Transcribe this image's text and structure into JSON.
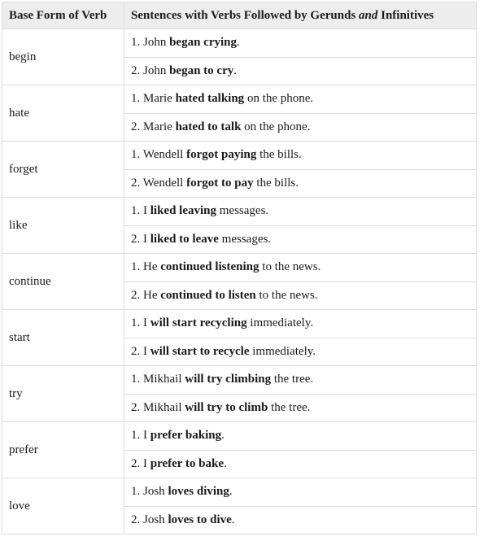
{
  "table": {
    "headers": {
      "verb": "Base Form of Verb",
      "sentences_pre": "Sentences with Verbs Followed by Gerunds ",
      "sentences_italic": "and",
      "sentences_post": " Infinitives"
    },
    "rows": [
      {
        "verb": "begin",
        "sentences": [
          {
            "num": "1.",
            "pre": "John ",
            "bold": "began crying",
            "post": "."
          },
          {
            "num": "2.",
            "pre": "John ",
            "bold": "began to cry",
            "post": "."
          }
        ]
      },
      {
        "verb": "hate",
        "sentences": [
          {
            "num": "1.",
            "pre": "Marie ",
            "bold": "hated talking",
            "post": " on the phone."
          },
          {
            "num": "2.",
            "pre": "Marie ",
            "bold": "hated to talk",
            "post": " on the phone."
          }
        ]
      },
      {
        "verb": "forget",
        "sentences": [
          {
            "num": "1.",
            "pre": "Wendell ",
            "bold": "forgot paying",
            "post": " the bills."
          },
          {
            "num": "2.",
            "pre": "Wendell ",
            "bold": "forgot to pay",
            "post": " the bills."
          }
        ]
      },
      {
        "verb": "like",
        "sentences": [
          {
            "num": "1.",
            "pre": "I ",
            "bold": "liked leaving",
            "post": " messages."
          },
          {
            "num": "2.",
            "pre": "I ",
            "bold": "liked to leave",
            "post": " messages."
          }
        ]
      },
      {
        "verb": "continue",
        "sentences": [
          {
            "num": "1.",
            "pre": "He ",
            "bold": "continued listening",
            "post": " to the news."
          },
          {
            "num": "2.",
            "pre": "He ",
            "bold": "continued to listen",
            "post": " to the news."
          }
        ]
      },
      {
        "verb": "start",
        "sentences": [
          {
            "num": "1.",
            "pre": "I ",
            "bold": "will start recycling",
            "post": " immediately."
          },
          {
            "num": "2.",
            "pre": "I ",
            "bold": "will start to recycle",
            "post": " immediately."
          }
        ]
      },
      {
        "verb": "try",
        "sentences": [
          {
            "num": "1.",
            "pre": "Mikhail ",
            "bold": "will try climbing",
            "post": " the tree."
          },
          {
            "num": "2.",
            "pre": "Mikhail ",
            "bold": "will try to climb",
            "post": " the tree."
          }
        ]
      },
      {
        "verb": "prefer",
        "sentences": [
          {
            "num": "1.",
            "pre": "I ",
            "bold": "prefer baking",
            "post": "."
          },
          {
            "num": "2.",
            "pre": "I ",
            "bold": "prefer to bake",
            "post": "."
          }
        ]
      },
      {
        "verb": "love",
        "sentences": [
          {
            "num": "1.",
            "pre": "Josh ",
            "bold": "loves diving",
            "post": "."
          },
          {
            "num": "2.",
            "pre": "Josh ",
            "bold": "loves to dive",
            "post": "."
          }
        ]
      }
    ]
  }
}
